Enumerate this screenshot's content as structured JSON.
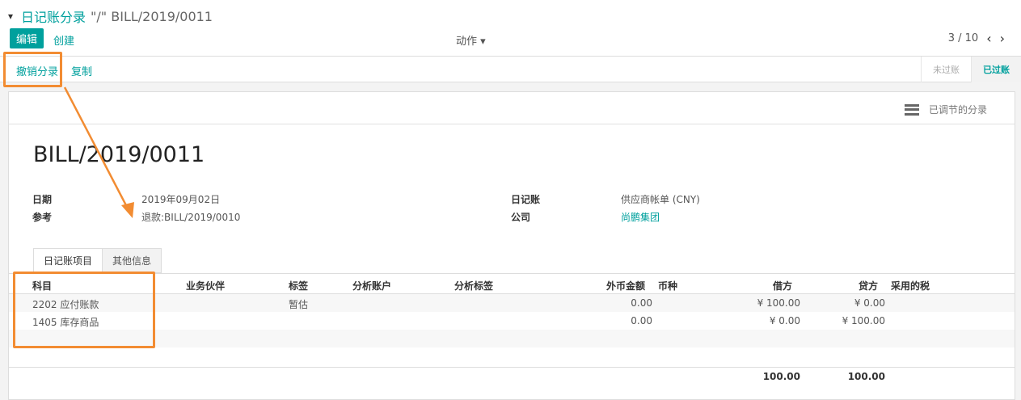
{
  "breadcrumb": {
    "link": "日记账分录",
    "rest": "\"/\" BILL/2019/0011"
  },
  "toolbar": {
    "edit": "编辑",
    "create": "创建",
    "actions": "动作 ▾"
  },
  "pager": {
    "text": "3 / 10"
  },
  "status_bar": {
    "reverse": "撤销分录",
    "duplicate": "复制",
    "states": [
      "未过账",
      "已过账"
    ],
    "active_state": "已过账"
  },
  "sheet": {
    "reconcile_label": "已调节的分录",
    "title": "BILL/2019/0011",
    "fields": {
      "date_label": "日期",
      "date": "2019年09月02日",
      "ref_label": "参考",
      "ref": "退款:BILL/2019/0010",
      "journal_label": "日记账",
      "journal": "供应商帐单 (CNY)",
      "company_label": "公司",
      "company": "尚鹏集团"
    },
    "tabs": [
      "日记账项目",
      "其他信息"
    ]
  },
  "table": {
    "headers": [
      "科目",
      "业务伙伴",
      "标签",
      "分析账户",
      "分析标签",
      "外币金额",
      "币种",
      "借方",
      "贷方",
      "采用的税"
    ],
    "rows": [
      {
        "account": "2202 应付账款",
        "label": "暂估",
        "amount_currency": "0.00",
        "debit": "¥ 100.00",
        "credit": "¥ 0.00"
      },
      {
        "account": "1405 库存商品",
        "label": "",
        "amount_currency": "0.00",
        "debit": "¥ 0.00",
        "credit": "¥ 100.00"
      }
    ],
    "totals": {
      "debit": "100.00",
      "credit": "100.00"
    }
  },
  "annotation_color": "#f28c32",
  "accent_color": "#00a09d"
}
